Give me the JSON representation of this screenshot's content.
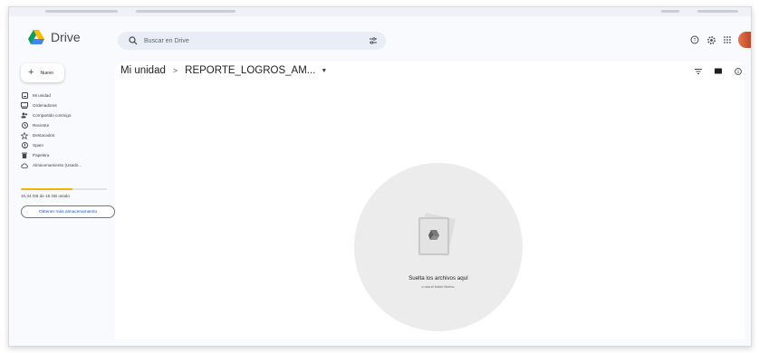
{
  "header": {
    "app_name": "Drive",
    "search_placeholder": "Buscar en Drive"
  },
  "sidebar": {
    "new_label": "Nuevo",
    "items": [
      {
        "label": "Mi unidad",
        "icon": "drive-icon"
      },
      {
        "label": "Ordenadores",
        "icon": "computer-icon"
      },
      {
        "label": "Compartido conmigo",
        "icon": "people-icon"
      },
      {
        "label": "Reciente",
        "icon": "clock-icon"
      },
      {
        "label": "Destacados",
        "icon": "star-icon"
      },
      {
        "label": "Spam",
        "icon": "spam-icon"
      },
      {
        "label": "Papelera",
        "icon": "trash-icon"
      },
      {
        "label": "Almacenamiento (Usado...",
        "icon": "cloud-icon"
      }
    ],
    "storage_used_fraction": 0.6,
    "storage_text": "10,34 GB de 15 GB usado",
    "more_storage_label": "Obtener más almacenamiento"
  },
  "main": {
    "breadcrumb_root": "Mi unidad",
    "breadcrumb_separator": ">",
    "breadcrumb_current": "REPORTE_LOGROS_AM...",
    "drop_title": "Suelta los archivos aquí",
    "drop_subtitle": "o usa el botón Nuevo."
  },
  "colors": {
    "accent": "#0b57d0",
    "storage_fill": "#f4b400",
    "sidebar_bg": "#f8fafd",
    "search_bg": "#e9eef6",
    "avatar": "#d2603f"
  }
}
